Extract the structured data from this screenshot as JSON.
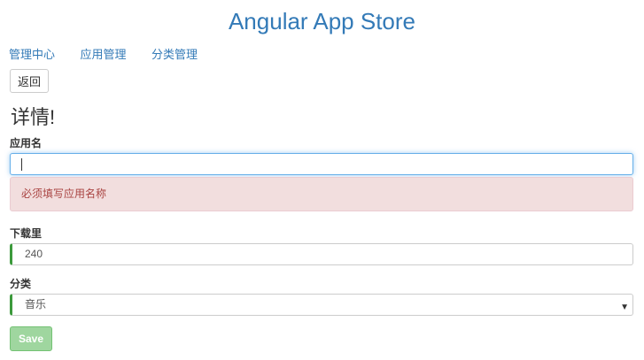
{
  "app": {
    "title": "Angular App Store"
  },
  "nav": {
    "items": [
      {
        "label": "管理中心"
      },
      {
        "label": "应用管理"
      },
      {
        "label": "分类管理"
      }
    ]
  },
  "toolbar": {
    "back_label": "返回"
  },
  "page": {
    "heading": "详情!"
  },
  "form": {
    "name": {
      "label": "应用名",
      "value": "",
      "error": "必须填写应用名称"
    },
    "downloads": {
      "label": "下载里",
      "value": "240"
    },
    "category": {
      "label": "分类",
      "selected": "音乐"
    },
    "save_label": "Save"
  },
  "colors": {
    "accent": "#337ab7",
    "error_bg": "#f2dede",
    "error_text": "#a94442",
    "valid_border": "#3c9a3c",
    "save_bg": "#8fd08f"
  },
  "icons": {
    "select_arrow": "chevron-down-icon"
  }
}
